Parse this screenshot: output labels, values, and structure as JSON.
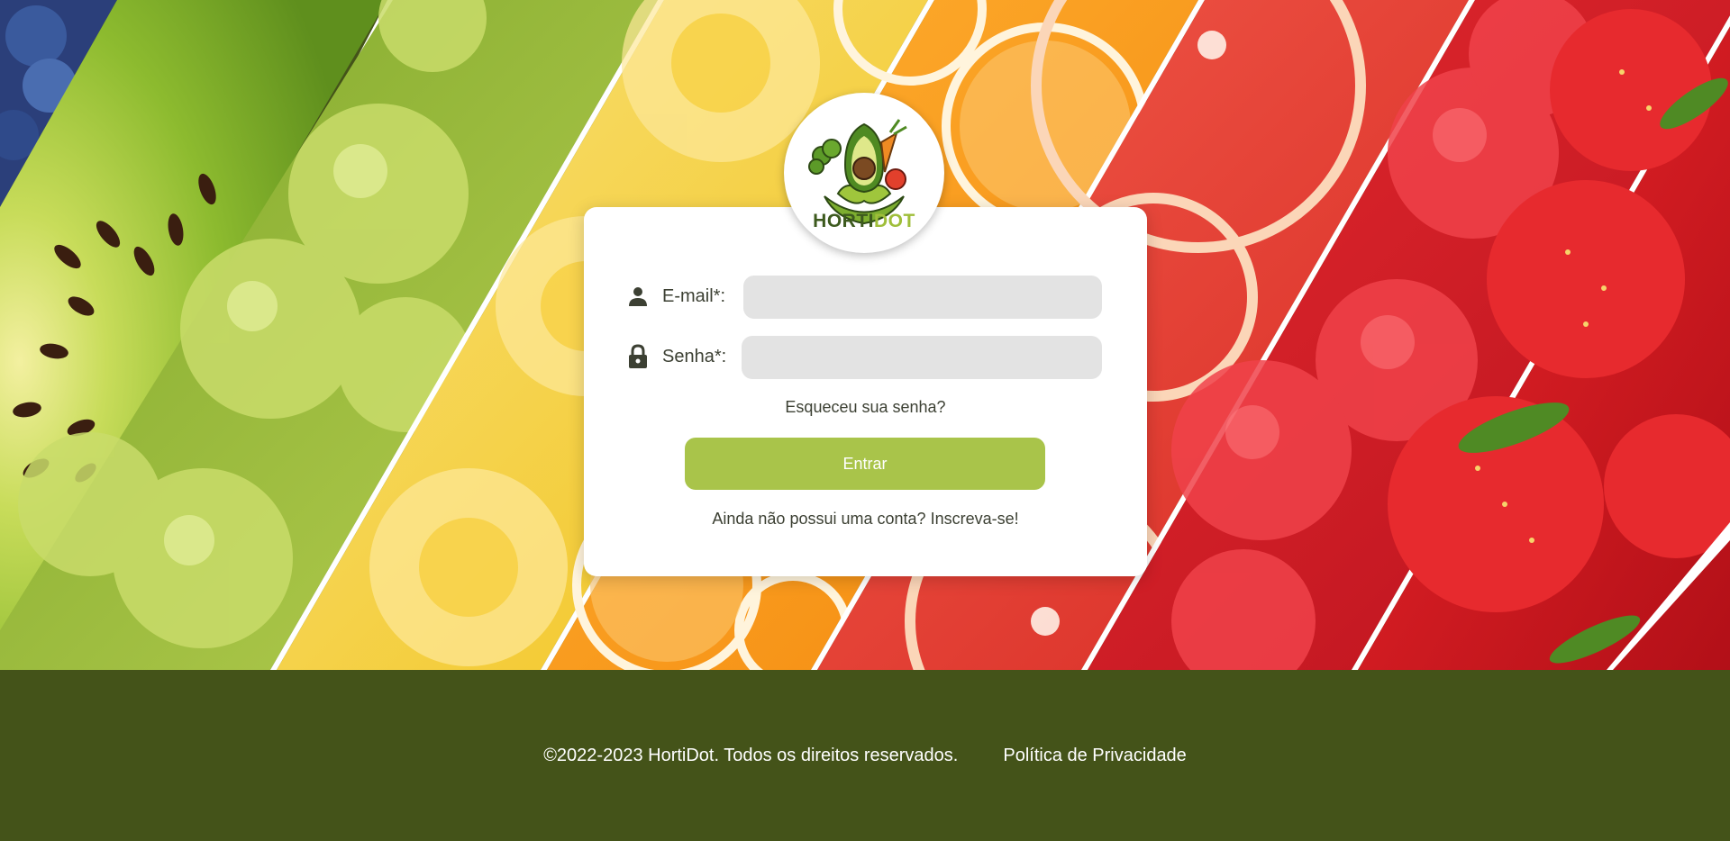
{
  "brand": {
    "name_part1": "HORTI",
    "name_part2": "DOT",
    "colors": {
      "dark_green": "#3d5a1e",
      "light_green": "#9fbe3a",
      "footer": "#445319",
      "button": "#a9c44a"
    }
  },
  "login": {
    "email_label": "E-mail*:",
    "email_value": "",
    "email_icon": "user-icon",
    "password_label": "Senha*:",
    "password_value": "",
    "password_icon": "lock-icon",
    "forgot_link": "Esqueceu sua senha?",
    "submit_label": "Entrar",
    "signup_prompt": "Ainda não possui uma conta?",
    "signup_link": "Inscreva-se!"
  },
  "footer": {
    "copyright": "©2022-2023 HortiDot. Todos os direitos reservados.",
    "privacy_link": "Política de Privacidade"
  }
}
